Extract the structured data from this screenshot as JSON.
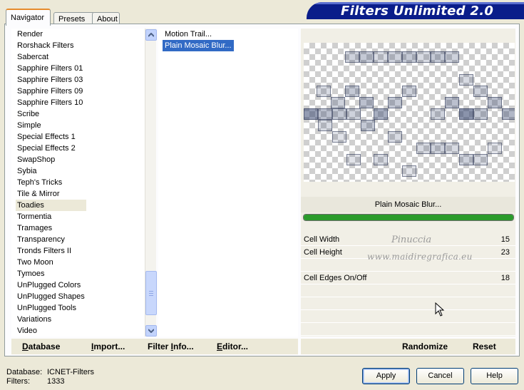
{
  "tabs": [
    "Navigator",
    "Presets",
    "About"
  ],
  "banner_title": "Filters Unlimited 2.0",
  "categories": [
    "Render",
    "Rorshack Filters",
    "Sabercat",
    "Sapphire Filters 01",
    "Sapphire Filters 03",
    "Sapphire Filters 09",
    "Sapphire Filters 10",
    "Scribe",
    "Simple",
    "Special Effects 1",
    "Special Effects 2",
    "SwapShop",
    "Sybia",
    "Teph's Tricks",
    "Tile & Mirror",
    "Toadies",
    "Tormentia",
    "Tramages",
    "Transparency",
    "Tronds Filters II",
    "Two Moon",
    "Tymoes",
    "UnPlugged Colors",
    "UnPlugged Shapes",
    "UnPlugged Tools",
    "Variations",
    "Video"
  ],
  "selected_category": "Toadies",
  "filters": [
    "Motion Trail...",
    "Plain Mosaic Blur..."
  ],
  "selected_filter": "Plain Mosaic Blur...",
  "current_filter_name": "Plain Mosaic Blur...",
  "progress": 1.0,
  "params": [
    {
      "label": "Cell Width",
      "value": "15"
    },
    {
      "label": "Cell Height",
      "value": "23"
    },
    {
      "label": "",
      "value": ""
    },
    {
      "label": "Cell Edges On/Off",
      "value": "18"
    },
    {
      "label": "",
      "value": ""
    },
    {
      "label": "",
      "value": ""
    },
    {
      "label": "",
      "value": ""
    },
    {
      "label": "",
      "value": ""
    }
  ],
  "watermark": {
    "line1": "Pinuccia",
    "line2": "www.maidiregrafica.eu"
  },
  "left_buttons": [
    {
      "label": "Database",
      "ul": "D"
    },
    {
      "label": "Import...",
      "ul": "I"
    },
    {
      "label": "Filter Info...",
      "ul": "I"
    },
    {
      "label": "Editor...",
      "ul": "E"
    }
  ],
  "right_buttons": [
    "Randomize",
    "Reset"
  ],
  "info": {
    "database_label": "Database:",
    "database_value": "ICNET-Filters",
    "filters_label": "Filters:",
    "filters_value": "1333"
  },
  "dialog_buttons": {
    "apply": "Apply",
    "cancel": "Cancel",
    "help": "Help"
  }
}
